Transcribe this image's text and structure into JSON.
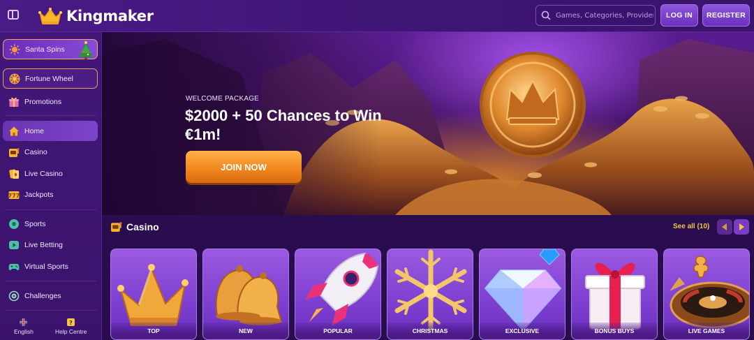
{
  "header": {
    "logo_text": "Kingmaker",
    "search_placeholder": "Games, Categories, Providers",
    "login_label": "LOG IN",
    "register_label": "REGISTER"
  },
  "sidebar": {
    "items": [
      {
        "label": "Santa Spins",
        "icon": "sun-burst-icon"
      },
      {
        "label": "Fortune Wheel",
        "icon": "fortune-wheel-icon"
      },
      {
        "label": "Promotions",
        "icon": "gift-icon"
      },
      {
        "label": "Home",
        "icon": "home-icon"
      },
      {
        "label": "Casino",
        "icon": "slot-machine-icon"
      },
      {
        "label": "Live Casino",
        "icon": "cards-icon"
      },
      {
        "label": "Jackpots",
        "icon": "jackpot-icon"
      },
      {
        "label": "Sports",
        "icon": "football-icon"
      },
      {
        "label": "Live Betting",
        "icon": "live-play-icon"
      },
      {
        "label": "Virtual Sports",
        "icon": "gamepad-icon"
      },
      {
        "label": "Challenges",
        "icon": "challenge-icon"
      }
    ],
    "footer": {
      "language": "English",
      "help": "Help Centre"
    }
  },
  "hero": {
    "label": "WELCOME PACKAGE",
    "title": "$2000 + 50 Chances to Win €1m!",
    "cta": "JOIN NOW"
  },
  "casino": {
    "title": "Casino",
    "see_all": "See all (10)",
    "categories": [
      {
        "label": "TOP",
        "icon": "crown-icon"
      },
      {
        "label": "NEW",
        "icon": "bells-icon"
      },
      {
        "label": "POPULAR",
        "icon": "rocket-icon"
      },
      {
        "label": "CHRISTMAS",
        "icon": "snowflake-icon"
      },
      {
        "label": "EXCLUSIVE",
        "icon": "diamond-icon"
      },
      {
        "label": "BONUS BUYS",
        "icon": "gift-box-icon"
      },
      {
        "label": "LIVE GAMES",
        "icon": "roulette-icon"
      }
    ]
  },
  "colors": {
    "brand_purple": "#4a1a86",
    "accent_orange": "#f0841c",
    "see_all_gold": "#f5c542"
  }
}
